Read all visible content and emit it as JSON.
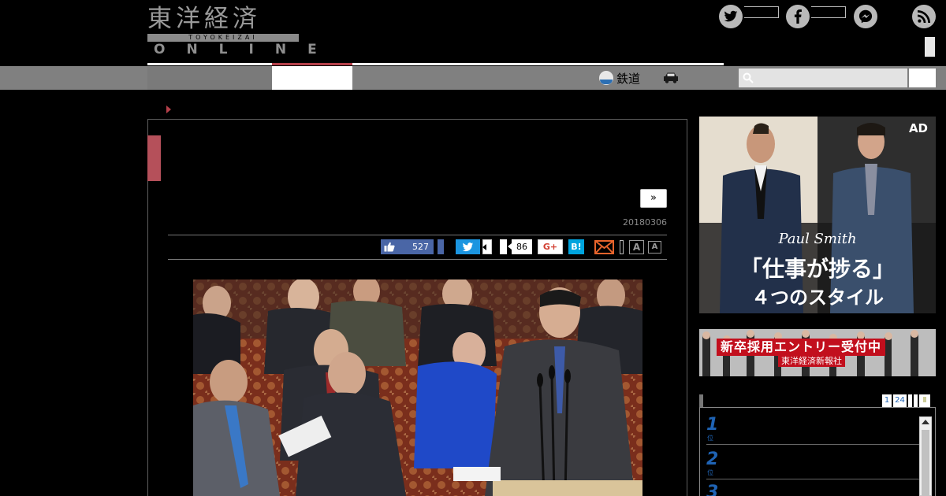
{
  "header": {
    "logo_jp": "東洋経済",
    "logo_sub": "TOYOKEIZAI",
    "logo_online": "ONLINE",
    "social": [
      "twitter-icon",
      "facebook-icon",
      "messenger-icon",
      "rss-icon"
    ]
  },
  "nav": {
    "rail_label": "鉄道",
    "search_placeholder": ""
  },
  "article": {
    "next_label": "»",
    "date": "20180306",
    "share": {
      "like_count": "527",
      "hatena_count": "86",
      "gplus_label": "G+",
      "hatena_label": "B!",
      "font_large": "A",
      "font_small": "A"
    }
  },
  "sidebar": {
    "ad": {
      "label": "AD",
      "brand": "Paul Smith",
      "headline": "「仕事が捗る」",
      "subline": "４つのスタイル"
    },
    "recruit": {
      "title": "新卒採用エントリー受付中",
      "company": "東洋経済新報社"
    },
    "ranking": {
      "tabs": [
        "1",
        "24"
      ],
      "items": [
        {
          "rank": "1",
          "unit": "位"
        },
        {
          "rank": "2",
          "unit": "位"
        },
        {
          "rank": "3",
          "unit": ""
        }
      ]
    }
  },
  "colors": {
    "accent_red": "#b5404a",
    "nav_gray": "#808080",
    "link_blue": "#1f63b4",
    "facebook": "#4a66a6",
    "twitter": "#1b95e0",
    "hatena": "#00a4de"
  }
}
